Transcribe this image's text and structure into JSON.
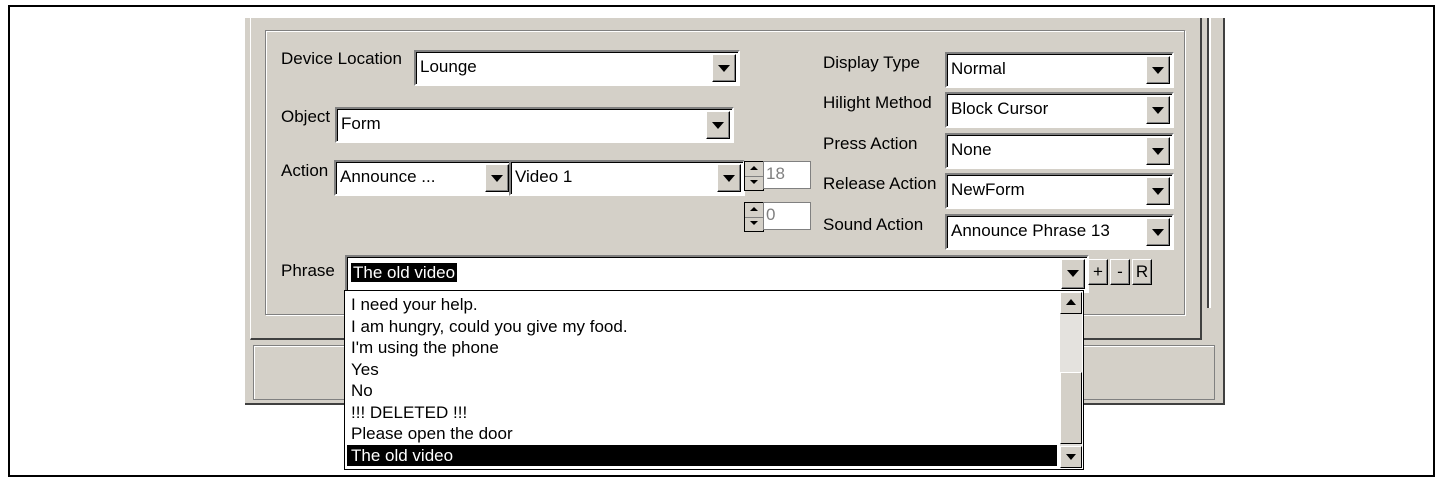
{
  "form": {
    "device_location": {
      "label": "Device Location",
      "value": "Lounge"
    },
    "object": {
      "label": "Object",
      "value": "Form"
    },
    "action": {
      "label": "Action",
      "type_value": "Announce ...",
      "target_value": "Video 1",
      "spin1_value": "18",
      "spin2_value": "0"
    },
    "phrase": {
      "label": "Phrase",
      "value": "The old video",
      "plus_label": "+",
      "minus_label": "-",
      "r_label": "R"
    }
  },
  "right_panel": {
    "display_type": {
      "label": "Display Type",
      "value": "Normal"
    },
    "hilight_method": {
      "label": "Hilight Method",
      "value": "Block Cursor"
    },
    "press_action": {
      "label": "Press Action",
      "value": "None"
    },
    "release_action": {
      "label": "Release Action",
      "value": "NewForm"
    },
    "sound_action": {
      "label": "Sound Action",
      "value": "Announce Phrase 13"
    }
  },
  "phrase_list": {
    "items": [
      "I need your help.",
      "I am hungry, could you give my food.",
      "I'm using the phone",
      "Yes",
      "No",
      "!!! DELETED !!!",
      "Please open the door",
      "The old video"
    ],
    "selected_index": 7
  }
}
